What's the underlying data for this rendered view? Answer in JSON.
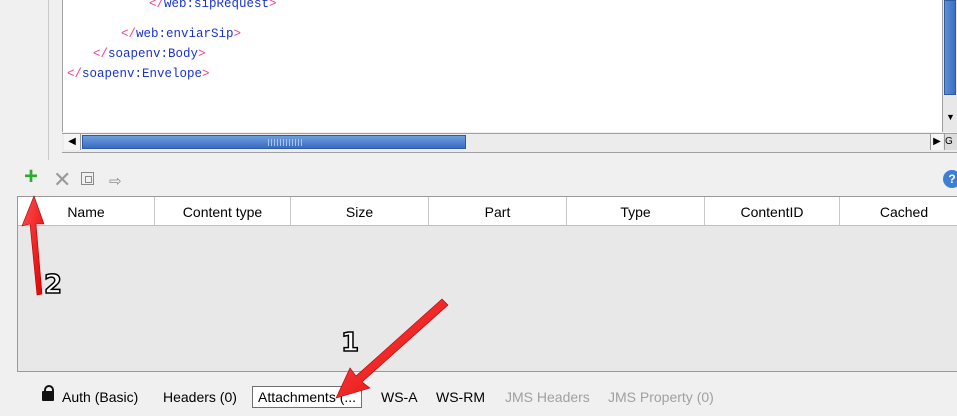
{
  "editor": {
    "lines": [
      {
        "open": "</",
        "name": "web:sipRequest",
        "close": ">"
      },
      {
        "open": "</",
        "name": "web:enviarSip",
        "close": ">"
      },
      {
        "open": "</",
        "name": "soapenv:Body",
        "close": ">"
      },
      {
        "open": "</",
        "name": "soapenv:Envelope",
        "close": ">"
      }
    ],
    "scroll_left_arrow": "◀",
    "scroll_right_arrow": "▶",
    "scroll_down_arrow": "▼",
    "corner_glyph": "G"
  },
  "toolbar": {
    "add_glyph": "+",
    "remove_glyph": "✕",
    "export_glyph": "⇨",
    "help_glyph": "?"
  },
  "table": {
    "columns": [
      "Name",
      "Content type",
      "Size",
      "Part",
      "Type",
      "ContentID",
      "Cached"
    ]
  },
  "tabs": [
    {
      "label": "Auth (Basic)",
      "state": "normal"
    },
    {
      "label": "Headers (0)",
      "state": "normal"
    },
    {
      "label": "Attachments (...",
      "state": "selected"
    },
    {
      "label": "WS-A",
      "state": "normal"
    },
    {
      "label": "WS-RM",
      "state": "normal"
    },
    {
      "label": "JMS Headers",
      "state": "disabled"
    },
    {
      "label": "JMS Property (0)",
      "state": "disabled"
    }
  ],
  "annotations": {
    "label_1": "1",
    "label_2": "2",
    "arrow_color": "#ff2a2a"
  }
}
